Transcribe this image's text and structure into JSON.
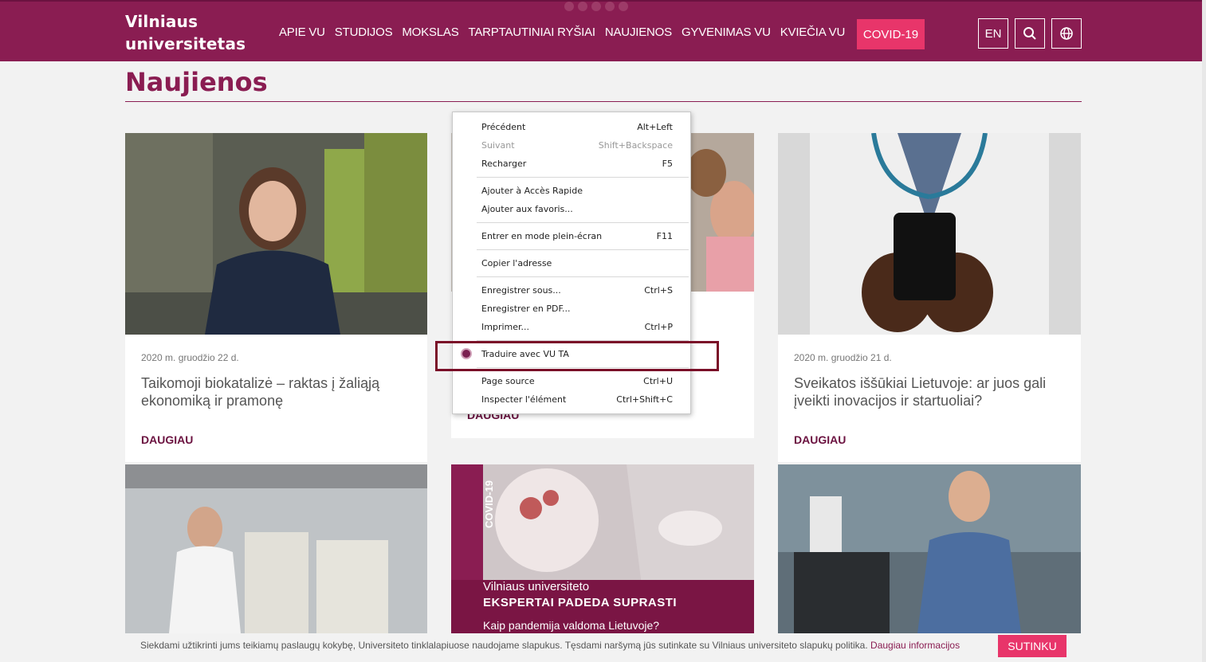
{
  "header": {
    "logo_line1": "Vilniaus",
    "logo_line2": "universitetas",
    "nav": [
      "APIE VU",
      "STUDIJOS",
      "MOKSLAS",
      "TARPTAUTINIAI RYŠIAI",
      "NAUJIENOS",
      "GYVENIMAS VU",
      "KVIEČIA VU"
    ],
    "covid_label": "COVID-19",
    "lang_label": "EN",
    "colors": {
      "brand": "#8a1d52",
      "accent": "#e8356a"
    }
  },
  "page_title": "Naujienos",
  "cards": [
    {
      "date": "2020 m. gruodžio 22 d.",
      "title": "Taikomoji biokatalizė – raktas į žaliąją ekonomiką ir pramonę",
      "more": "DAUGIAU"
    },
    {
      "date": "",
      "title": "",
      "more": "DAUGIAU"
    },
    {
      "date": "2020 m. gruodžio 21 d.",
      "title": "Sveikatos iššūkiai Lietuvoje: ar juos gali įveikti inovacijos ir startuoliai?",
      "more": "DAUGIAU"
    }
  ],
  "promo": {
    "tag": "COVID-19",
    "line1": "Vilniaus universiteto",
    "line2": "EKSPERTAI PADEDA SUPRASTI",
    "line3": "Kaip pandemija valdoma Lietuvoje?"
  },
  "context_menu": {
    "items": [
      {
        "label": "Précédent",
        "shortcut": "Alt+Left"
      },
      {
        "label": "Suivant",
        "shortcut": "Shift+Backspace"
      },
      {
        "label": "Recharger",
        "shortcut": "F5"
      },
      {
        "label": "Ajouter à Accès Rapide",
        "shortcut": ""
      },
      {
        "label": "Ajouter aux favoris...",
        "shortcut": ""
      },
      {
        "label": "Entrer en mode plein-écran",
        "shortcut": "F11"
      },
      {
        "label": "Copier l'adresse",
        "shortcut": ""
      },
      {
        "label": "Enregistrer sous...",
        "shortcut": "Ctrl+S"
      },
      {
        "label": "Enregistrer en PDF...",
        "shortcut": ""
      },
      {
        "label": "Imprimer...",
        "shortcut": "Ctrl+P"
      },
      {
        "label": "Traduire avec VU TA",
        "shortcut": ""
      },
      {
        "label": "Page source",
        "shortcut": "Ctrl+U"
      },
      {
        "label": "Inspecter l'élément",
        "shortcut": "Ctrl+Shift+C"
      }
    ]
  },
  "cookie": {
    "text": "Siekdami užtikrinti jums teikiamų paslaugų kokybę, Universiteto tinklalapiuose naudojame slapukus. Tęsdami naršymą jūs sutinkate su Vilniaus universiteto slapukų politika.",
    "link": "Daugiau informacijos",
    "button": "SUTINKU"
  }
}
